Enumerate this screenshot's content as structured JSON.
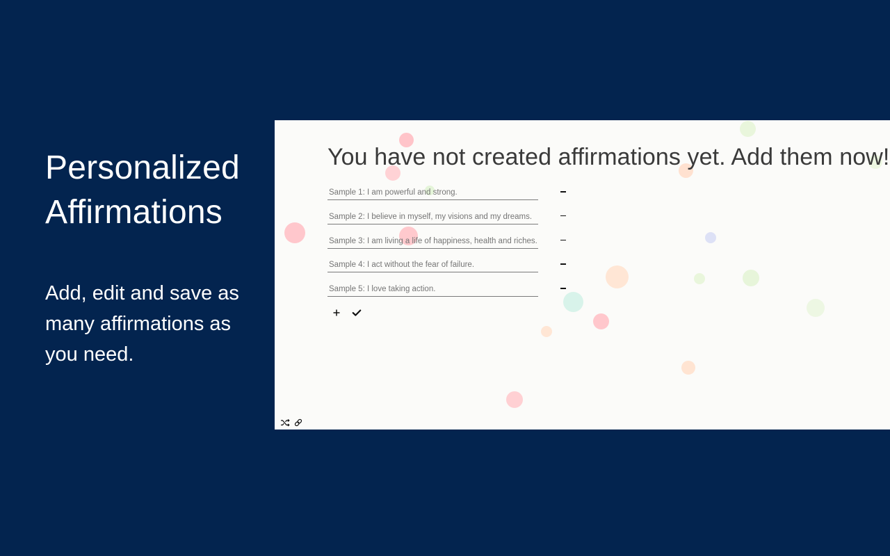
{
  "promo": {
    "title": "Personalized Affirmations",
    "description": "Add, edit and save as many affirmations as you need."
  },
  "app": {
    "heading": "You have not created affirmations yet. Add them now!",
    "affirmations": [
      {
        "placeholder": "Sample 1: I am powerful and strong."
      },
      {
        "placeholder": "Sample 2: I believe in myself, my visions and my dreams."
      },
      {
        "placeholder": "Sample 3: I am living a life of happiness, health and riches."
      },
      {
        "placeholder": "Sample 4: I act without the fear of failure."
      },
      {
        "placeholder": "Sample 5: I love taking action."
      }
    ],
    "icons": {
      "add": "plus-icon",
      "save": "checkmark-icon",
      "remove": "minus-icon",
      "shuffle": "shuffle-icon",
      "link": "link-icon"
    }
  },
  "colors": {
    "background": "#03244f",
    "panel": "#fbfbf9",
    "text": "#ffffff"
  }
}
